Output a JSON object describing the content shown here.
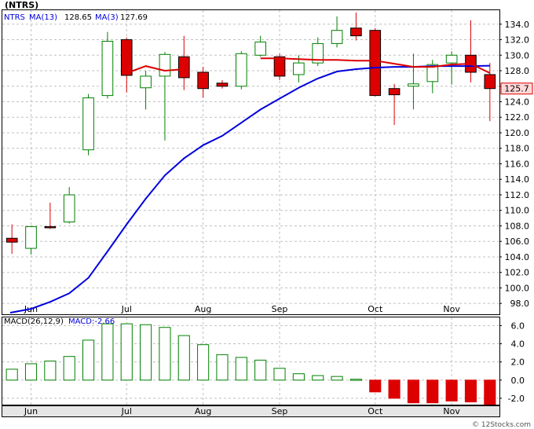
{
  "ticker_title": "(NTRS)",
  "legend": {
    "symbol": "NTRS",
    "ma13_label": "MA(13)",
    "ma13_value": "128.65",
    "ma3_label": "MA(3)",
    "ma3_value": "127.69",
    "ma13_color": "#0000dd",
    "ma3_color": "#dd0000"
  },
  "price_badge": "125.7",
  "watermark": "© 12Stocks.com",
  "macd_legend": {
    "label": "MACD(26,12,9)",
    "value_label": "MACD:-2.66"
  },
  "colors": {
    "up": "#008000",
    "down": "#dd0000",
    "ma13": "#0000dd",
    "ma3": "#dd0000",
    "grid": "#c0c0c0",
    "frame": "#000000",
    "bg": "#ffffff"
  },
  "chart_data": [
    {
      "type": "candlestick",
      "title": "(NTRS)",
      "weeks": 26,
      "x_tick_labels": [
        {
          "label": "Jun",
          "week": 1
        },
        {
          "label": "Jul",
          "week": 6
        },
        {
          "label": "Aug",
          "week": 10
        },
        {
          "label": "Sep",
          "week": 14
        },
        {
          "label": "Oct",
          "week": 19
        },
        {
          "label": "Nov",
          "week": 23
        }
      ],
      "y_ticks": [
        98,
        100,
        102,
        104,
        106,
        108,
        110,
        112,
        114,
        116,
        118,
        120,
        122,
        124,
        126,
        128,
        130,
        132,
        134
      ],
      "ylim": [
        96.6,
        135.8
      ],
      "grid": true,
      "candles": [
        {
          "o": 106.4,
          "h": 108.2,
          "l": 104.4,
          "c": 105.9
        },
        {
          "o": 105.1,
          "h": 108.0,
          "l": 104.3,
          "c": 107.9
        },
        {
          "o": 107.9,
          "h": 111.0,
          "l": 107.6,
          "c": 107.8
        },
        {
          "o": 108.5,
          "h": 113.0,
          "l": 108.3,
          "c": 112.0
        },
        {
          "o": 117.8,
          "h": 125.0,
          "l": 117.1,
          "c": 124.5
        },
        {
          "o": 124.8,
          "h": 133.0,
          "l": 124.4,
          "c": 131.8
        },
        {
          "o": 132.0,
          "h": 132.3,
          "l": 125.2,
          "c": 127.4
        },
        {
          "o": 125.8,
          "h": 128.0,
          "l": 123.0,
          "c": 127.3
        },
        {
          "o": 127.3,
          "h": 130.4,
          "l": 119.0,
          "c": 130.1
        },
        {
          "o": 129.8,
          "h": 132.5,
          "l": 125.5,
          "c": 127.1
        },
        {
          "o": 127.8,
          "h": 128.5,
          "l": 124.5,
          "c": 125.7
        },
        {
          "o": 126.4,
          "h": 126.8,
          "l": 125.7,
          "c": 126.0
        },
        {
          "o": 126.0,
          "h": 130.5,
          "l": 125.6,
          "c": 130.2
        },
        {
          "o": 130.0,
          "h": 132.5,
          "l": 129.8,
          "c": 131.7
        },
        {
          "o": 129.8,
          "h": 130.2,
          "l": 126.8,
          "c": 127.3
        },
        {
          "o": 127.5,
          "h": 130.0,
          "l": 126.5,
          "c": 129.0
        },
        {
          "o": 129.0,
          "h": 132.3,
          "l": 128.6,
          "c": 131.5
        },
        {
          "o": 131.5,
          "h": 135.0,
          "l": 131.0,
          "c": 133.2
        },
        {
          "o": 133.5,
          "h": 135.5,
          "l": 131.9,
          "c": 132.5
        },
        {
          "o": 133.2,
          "h": 133.5,
          "l": 124.7,
          "c": 124.8
        },
        {
          "o": 125.7,
          "h": 126.3,
          "l": 121.0,
          "c": 124.9
        },
        {
          "o": 126.0,
          "h": 130.2,
          "l": 123.0,
          "c": 126.3
        },
        {
          "o": 126.6,
          "h": 129.4,
          "l": 125.1,
          "c": 128.8
        },
        {
          "o": 129.0,
          "h": 130.5,
          "l": 126.2,
          "c": 130.0
        },
        {
          "o": 130.0,
          "h": 134.5,
          "l": 126.5,
          "c": 127.8
        },
        {
          "o": 127.5,
          "h": 129.0,
          "l": 121.5,
          "c": 125.7
        }
      ],
      "ma13": [
        96.8,
        97.3,
        98.2,
        99.3,
        101.3,
        104.7,
        108.2,
        111.5,
        114.5,
        116.7,
        118.4,
        119.6,
        121.3,
        123.0,
        124.4,
        125.8,
        127.0,
        127.9,
        128.2,
        128.4,
        128.5,
        128.5,
        128.6,
        128.6,
        128.6,
        128.65
      ],
      "ma3": [
        null,
        null,
        null,
        null,
        null,
        null,
        127.7,
        128.6,
        128.0,
        128.2,
        null,
        null,
        null,
        129.6,
        129.6,
        129.5,
        129.4,
        129.4,
        129.3,
        129.3,
        128.9,
        128.5,
        128.5,
        128.8,
        128.9,
        127.7
      ],
      "ma13_start_week": 1,
      "ma3_segments": [
        [
          6,
          9
        ],
        [
          13,
          25
        ]
      ],
      "last_price": 125.7
    },
    {
      "type": "bar",
      "title": "MACD(26,12,9)",
      "y_ticks": [
        -2.0,
        0.0,
        2.0,
        4.0,
        6.0
      ],
      "ylim": [
        -2.7,
        6.9
      ],
      "values": [
        1.2,
        1.8,
        2.1,
        2.6,
        4.4,
        6.2,
        6.2,
        6.1,
        5.8,
        4.9,
        3.9,
        2.8,
        2.5,
        2.2,
        1.3,
        0.7,
        0.5,
        0.4,
        0.1,
        -1.3,
        -2.0,
        -2.5,
        -2.5,
        -2.3,
        -2.4,
        -2.66
      ],
      "last_value": -2.66
    }
  ]
}
